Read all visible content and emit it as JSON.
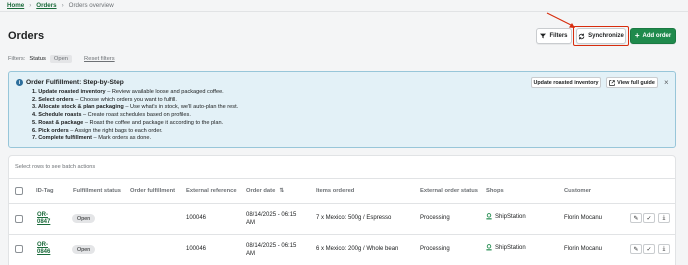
{
  "breadcrumb": {
    "home": "Home",
    "orders": "Orders",
    "current": "Orders overview",
    "separator": "›"
  },
  "header": {
    "title": "Orders",
    "filters_label": "Filters",
    "sync_label": "Synchronize",
    "add_label": "Add order"
  },
  "filters": {
    "label": "Filters:",
    "status_label": "Status",
    "status_value": "Open",
    "reset_label": "Reset filters"
  },
  "banner": {
    "title": "Order Fulfillment: Step-by-Step",
    "update_btn": "Update roasted inventory",
    "guide_btn": "View full guide",
    "close": "×",
    "steps": [
      {
        "bold": "1. Update roasted inventory",
        "text": " – Review available loose and packaged coffee."
      },
      {
        "bold": "2. Select orders",
        "text": " – Choose which orders you want to fulfill."
      },
      {
        "bold": "3. Allocate stock & plan packaging",
        "text": " – Use what's in stock, we'll auto-plan the rest."
      },
      {
        "bold": "4. Schedule roasts",
        "text": " – Create roast schedules based on profiles."
      },
      {
        "bold": "5. Roast & package",
        "text": " – Roast the coffee and package it according to the plan."
      },
      {
        "bold": "6. Pick orders",
        "text": " – Assign the right bags to each order."
      },
      {
        "bold": "7. Complete fulfillment",
        "text": " – Mark orders as done."
      }
    ]
  },
  "table": {
    "batch_hint": "Select rows to see batch actions",
    "columns": {
      "id": "ID-Tag",
      "fulfillment_status": "Fulfillment status",
      "order_fulfillment": "Order fulfillment",
      "external_reference": "External reference",
      "order_date": "Order date",
      "items": "Items ordered",
      "external_status": "External order status",
      "shops": "Shops",
      "customer": "Customer"
    },
    "rows": [
      {
        "id": "OR-0847",
        "status": "Open",
        "external_ref": "100046",
        "date": "08/14/2025 - 06:15 AM",
        "items": "7 x Mexico: 500g / Espresso",
        "external_status": "Processing",
        "shop": "ShipStation",
        "customer": "Florin Mocanu"
      },
      {
        "id": "OR-0846",
        "status": "Open",
        "external_ref": "100046",
        "date": "08/14/2025 - 06:15 AM",
        "items": "6 x Mexico: 200g / Whole bean",
        "external_status": "Processing",
        "shop": "ShipStation",
        "customer": "Florin Mocanu"
      }
    ]
  },
  "colors": {
    "accent_green": "#1f8a4c",
    "highlight_red": "#d72c0d",
    "banner_bg": "#e3f1f7"
  }
}
